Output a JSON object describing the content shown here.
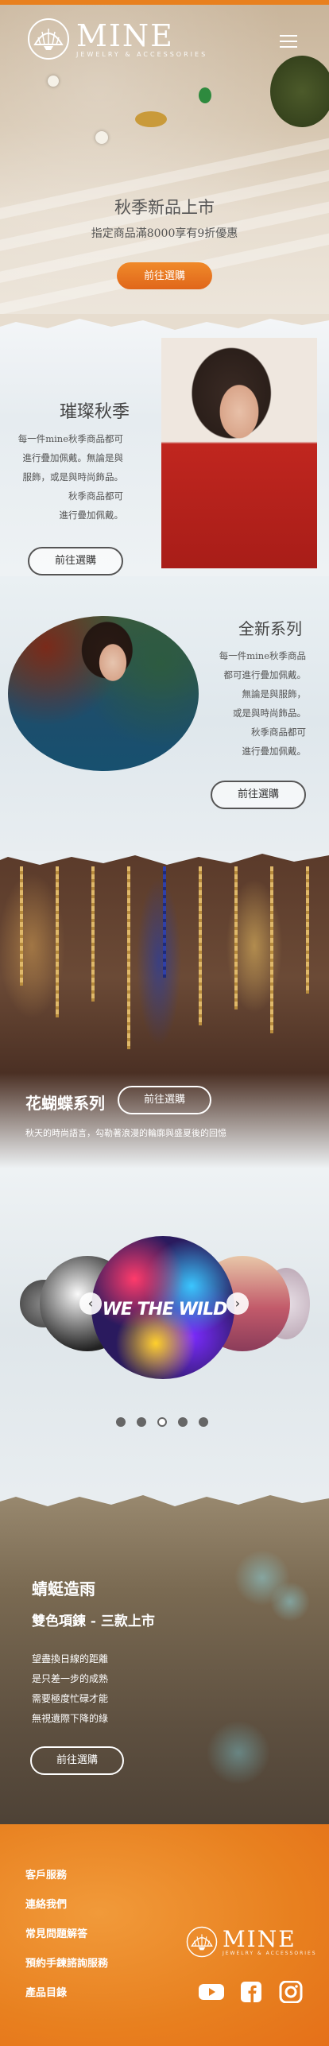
{
  "brand": {
    "name": "MINE",
    "tagline": "JEWELRY & ACCESSORIES"
  },
  "colors": {
    "accent": "#e8801f",
    "button_gradient_top": "#f08a2a",
    "button_gradient_bottom": "#e0661a"
  },
  "hero": {
    "title": "秋季新品上市",
    "subtitle": "指定商品滿8000享有9折優惠",
    "button": "前往選購"
  },
  "autumn": {
    "title": "璀璨秋季",
    "lines": [
      "每一件mine秋季商品都可",
      "進行疊加佩戴。無論是與",
      "服飾，或是與時尚飾品。",
      "秋季商品都可",
      "進行疊加佩戴。"
    ],
    "button": "前往選購"
  },
  "new_series": {
    "title": "全新系列",
    "lines": [
      "每一件mine秋季商品",
      "都可進行疊加佩戴。",
      "無論是與服飾，",
      "或是與時尚飾品。",
      "秋季商品都可",
      "進行疊加佩戴。"
    ],
    "button": "前往選購"
  },
  "butterfly": {
    "title": "花蝴蝶系列",
    "button": "前往選購",
    "subtitle": "秋天的時尚語言，勾勒著浪漫的輪廓與盛夏後的回憶"
  },
  "carousel": {
    "featured_text": "WE THE WILD",
    "prev_icon": "chevron-left-icon",
    "next_icon": "chevron-right-icon",
    "dots": 5,
    "active_dot": 2
  },
  "dragonfly": {
    "title": "蜻蜓造雨",
    "subtitle": "雙色項鍊 - 三款上市",
    "lines": [
      "望盡換日線的距離",
      "是只差一步的成熟",
      "需要極度忙碌才能",
      "無視遺際下降的綠"
    ],
    "button": "前往選購"
  },
  "footer": {
    "links": [
      "客戶服務",
      "連絡我們",
      "常見問題解答",
      "預約手鍊諮詢服務",
      "產品目錄"
    ],
    "social": [
      "youtube-icon",
      "facebook-icon",
      "instagram-icon"
    ]
  }
}
